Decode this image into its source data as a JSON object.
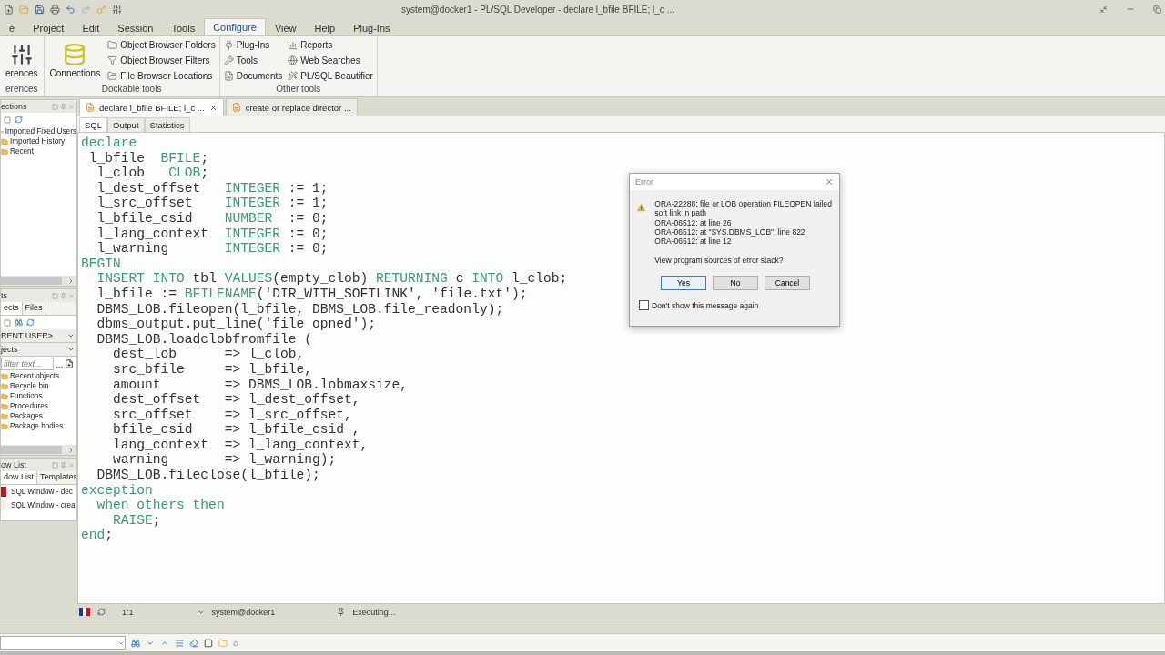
{
  "window": {
    "title": "system@docker1 - PL/SQL Developer - declare l_bfile BFILE; l_c ..."
  },
  "menu_tabs": [
    {
      "label": "e",
      "selected": false
    },
    {
      "label": "Project",
      "selected": false
    },
    {
      "label": "Edit",
      "selected": false
    },
    {
      "label": "Session",
      "selected": false
    },
    {
      "label": "Tools",
      "selected": false
    },
    {
      "label": "Configure",
      "selected": true
    },
    {
      "label": "View",
      "selected": false
    },
    {
      "label": "Help",
      "selected": false
    },
    {
      "label": "Plug-Ins",
      "selected": false
    }
  ],
  "ribbon": [
    {
      "label": "erences",
      "columns": [
        [
          {
            "label": "erences",
            "kind": "large"
          }
        ]
      ]
    },
    {
      "label": "Dockable tools",
      "columns": [
        [
          {
            "label": "Connections",
            "kind": "large"
          }
        ],
        [
          {
            "label": "Object Browser Folders",
            "kind": "small"
          },
          {
            "label": "Object Browser Filters",
            "kind": "small"
          },
          {
            "label": "File Browser Locations",
            "kind": "small"
          }
        ]
      ]
    },
    {
      "label": "Other tools",
      "columns": [
        [
          {
            "label": "Plug-Ins",
            "kind": "small"
          },
          {
            "label": "Tools",
            "kind": "small"
          },
          {
            "label": "Documents",
            "kind": "small"
          }
        ],
        [
          {
            "label": "Reports",
            "kind": "small"
          },
          {
            "label": "Web Searches",
            "kind": "small"
          },
          {
            "label": "PL/SQL Beautifier",
            "kind": "small"
          }
        ]
      ]
    }
  ],
  "connections_panel": {
    "title": "ections",
    "items": [
      "Imported Fixed Users",
      "Imported History",
      "Recent"
    ]
  },
  "objects_panel": {
    "title": "ts",
    "tabs": [
      {
        "label": "ects",
        "selected": true
      },
      {
        "label": "Files",
        "selected": false
      }
    ],
    "user_select": "RENT USER>",
    "type_select": "jects",
    "filter": {
      "placeholder": "filter text..."
    },
    "filter_button": "...",
    "items": [
      "Recent objects",
      "Recycle bin",
      "Functions",
      "Procedures",
      "Packages",
      "Package bodies"
    ]
  },
  "window_list_panel": {
    "title": "ow List",
    "tabs": [
      {
        "label": "dow List",
        "selected": true
      },
      {
        "label": "Templates",
        "selected": false
      }
    ],
    "items": [
      {
        "label": "SQL Window - dec",
        "color": "#c0141e"
      },
      {
        "label": "SQL Window - crea",
        "color": "#f0f0f0"
      }
    ]
  },
  "editor_tabs": [
    {
      "label": "declare l_bfile BFILE; l_c ...",
      "selected": true,
      "closable": true
    },
    {
      "label": "create or replace director ...",
      "selected": false,
      "closable": false
    }
  ],
  "sub_tabs": [
    {
      "label": "SQL",
      "selected": true
    },
    {
      "label": "Output",
      "selected": false
    },
    {
      "label": "Statistics",
      "selected": false
    }
  ],
  "code": [
    [
      {
        "text": "declare",
        "kind": "keyword"
      }
    ],
    [
      {
        "text": " l_bfile  ",
        "kind": "plain"
      },
      {
        "text": "BFILE",
        "kind": "keyword"
      },
      {
        "text": ";",
        "kind": "plain"
      }
    ],
    [
      {
        "text": "  l_clob   ",
        "kind": "plain"
      },
      {
        "text": "CLOB",
        "kind": "keyword"
      },
      {
        "text": ";",
        "kind": "plain"
      }
    ],
    [
      {
        "text": "  l_dest_offset   ",
        "kind": "plain"
      },
      {
        "text": "INTEGER",
        "kind": "keyword"
      },
      {
        "text": " := 1;",
        "kind": "plain"
      }
    ],
    [
      {
        "text": "  l_src_offset    ",
        "kind": "plain"
      },
      {
        "text": "INTEGER",
        "kind": "keyword"
      },
      {
        "text": " := 1;",
        "kind": "plain"
      }
    ],
    [
      {
        "text": "  l_bfile_csid    ",
        "kind": "plain"
      },
      {
        "text": "NUMBER",
        "kind": "keyword"
      },
      {
        "text": "  := 0;",
        "kind": "plain"
      }
    ],
    [
      {
        "text": "  l_lang_context  ",
        "kind": "plain"
      },
      {
        "text": "INTEGER",
        "kind": "keyword"
      },
      {
        "text": " := 0;",
        "kind": "plain"
      }
    ],
    [
      {
        "text": "  l_warning       ",
        "kind": "plain"
      },
      {
        "text": "INTEGER",
        "kind": "keyword"
      },
      {
        "text": " := 0;",
        "kind": "plain"
      }
    ],
    [
      {
        "text": "BEGIN",
        "kind": "keyword"
      }
    ],
    [
      {
        "text": "  INSERT INTO",
        "kind": "keyword"
      },
      {
        "text": " tbl ",
        "kind": "plain"
      },
      {
        "text": "VALUES",
        "kind": "keyword"
      },
      {
        "text": "(empty_clob) ",
        "kind": "plain"
      },
      {
        "text": "RETURNING",
        "kind": "keyword"
      },
      {
        "text": " c ",
        "kind": "plain"
      },
      {
        "text": "INTO",
        "kind": "keyword"
      },
      {
        "text": " l_clob;",
        "kind": "plain"
      }
    ],
    [
      {
        "text": "  l_bfile := ",
        "kind": "plain"
      },
      {
        "text": "BFILENAME",
        "kind": "keyword"
      },
      {
        "text": "('DIR_WITH_SOFTLINK', 'file.txt');",
        "kind": "plain"
      }
    ],
    [
      {
        "text": "  DBMS_LOB.fileopen(l_bfile, DBMS_LOB.file_readonly);",
        "kind": "plain"
      }
    ],
    [
      {
        "text": "  dbms_output.put_line('file opned');",
        "kind": "plain"
      }
    ],
    [
      {
        "text": "  DBMS_LOB.loadclobfromfile (",
        "kind": "plain"
      }
    ],
    [
      {
        "text": "    dest_lob      => l_clob,",
        "kind": "plain"
      }
    ],
    [
      {
        "text": "    src_bfile     => l_bfile,",
        "kind": "plain"
      }
    ],
    [
      {
        "text": "    amount        => DBMS_LOB.lobmaxsize,",
        "kind": "plain"
      }
    ],
    [
      {
        "text": "    dest_offset   => l_dest_offset,",
        "kind": "plain"
      }
    ],
    [
      {
        "text": "    src_offset    => l_src_offset,",
        "kind": "plain"
      }
    ],
    [
      {
        "text": "    bfile_csid    => l_bfile_csid ,",
        "kind": "plain"
      }
    ],
    [
      {
        "text": "    lang_context  => l_lang_context,",
        "kind": "plain"
      }
    ],
    [
      {
        "text": "    warning       => l_warning);",
        "kind": "plain"
      }
    ],
    [
      {
        "text": "  DBMS_LOB.fileclose(l_bfile);",
        "kind": "plain"
      }
    ],
    [
      {
        "text": "exception",
        "kind": "keyword"
      }
    ],
    [
      {
        "text": "  when others then",
        "kind": "keyword"
      }
    ],
    [
      {
        "text": "    RAISE",
        "kind": "keyword"
      },
      {
        "text": ";",
        "kind": "plain"
      }
    ],
    [
      {
        "text": "end",
        "kind": "keyword"
      },
      {
        "text": ";",
        "kind": "plain"
      }
    ]
  ],
  "status_bar": {
    "position": "1:1",
    "connection": "system@docker1",
    "state": "Executing..."
  },
  "error_dialog": {
    "title": "Error",
    "lines": [
      "ORA-22288: file or LOB operation FILEOPEN failed",
      "soft link in path",
      "ORA-06512: at line 26",
      "ORA-06512: at \"SYS.DBMS_LOB\", line 822",
      "ORA-06512: at line 12"
    ],
    "question": "View program sources of error stack?",
    "buttons": [
      {
        "label": "Yes",
        "selected": true
      },
      {
        "label": "No",
        "selected": false
      },
      {
        "label": "Cancel",
        "selected": false
      }
    ],
    "dont_show": {
      "label": "Don't show this message again",
      "checked": false
    }
  }
}
